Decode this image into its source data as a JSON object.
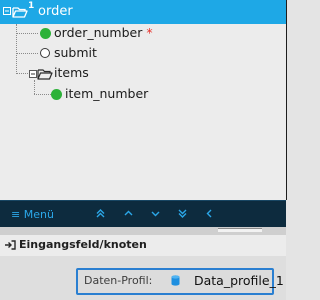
{
  "tree": {
    "root": {
      "label": "order",
      "occurrence": "1"
    },
    "nodes": [
      {
        "label": "order_number",
        "required": "*"
      },
      {
        "label": "submit"
      },
      {
        "label": "items"
      },
      {
        "label": "item_number"
      }
    ]
  },
  "toolbar": {
    "menu_label": "≡ Menü",
    "icons": [
      "double-up",
      "up",
      "down",
      "double-down",
      "left"
    ]
  },
  "properties": {
    "header": "Eingangsfeld/knoten",
    "field_label": "Daten-Profil:",
    "field_value": "Data_profile_1"
  },
  "colors": {
    "selected": "#1ea8e6",
    "toolbar": "#0d2b3e",
    "accent": "#2ba7e8",
    "leaf": "#2db239",
    "required": "#e8312a",
    "field_border": "#2a7fd1"
  }
}
